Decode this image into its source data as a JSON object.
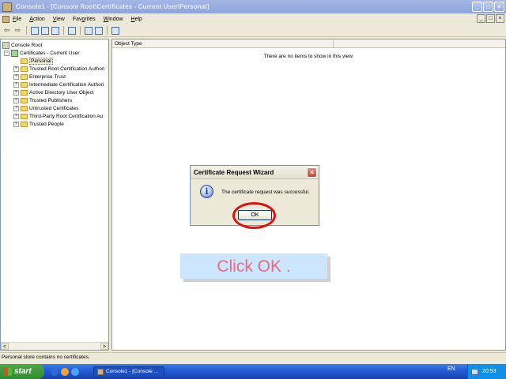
{
  "window": {
    "title": "Console1 - [Console Root\\Certificates - Current User\\Personal]"
  },
  "window_buttons": {
    "minimize": "_",
    "maximize": "□",
    "close": "×"
  },
  "menu": [
    {
      "pre": "",
      "u": "F",
      "post": "ile"
    },
    {
      "pre": "",
      "u": "A",
      "post": "ction"
    },
    {
      "pre": "",
      "u": "V",
      "post": "iew"
    },
    {
      "pre": "Fav",
      "u": "o",
      "post": "rites"
    },
    {
      "pre": "",
      "u": "W",
      "post": "indow"
    },
    {
      "pre": "",
      "u": "H",
      "post": "elp"
    }
  ],
  "toolbar": {
    "back": "⇦",
    "forward": "⇨",
    "up": "▲"
  },
  "tree": {
    "root": "Console Root",
    "certs": "Certificates - Current User",
    "selected": "Personal",
    "children": [
      "Trusted Root Certification Authori",
      "Enterprise Trust",
      "Intermediate Certification Authori",
      "Active Directory User Object",
      "Trusted Publishers",
      "Untrusted Certificates",
      "Third-Party Root Certification Au",
      "Trusted People"
    ],
    "expand_glyph": "+",
    "collapse_glyph": "−",
    "scroll_left": "<",
    "scroll_right": ">"
  },
  "content": {
    "column_header": "Object Type",
    "empty_message": "There are no items to show in this view."
  },
  "status": "Personal store contains no certificates.",
  "dialog": {
    "title": "Certificate Request Wizard",
    "close": "×",
    "icon": "i",
    "message": "The certificate request was successful.",
    "ok_label": "OK"
  },
  "callout": "Click OK .",
  "taskbar": {
    "start_label": "start",
    "task_label": "Console1 - [Console ...",
    "lang": "EN",
    "clock": "20:53"
  },
  "colors": {
    "accent_red": "#e01010",
    "callout_bg": "#cce6ff",
    "callout_text": "#e86a7e"
  }
}
